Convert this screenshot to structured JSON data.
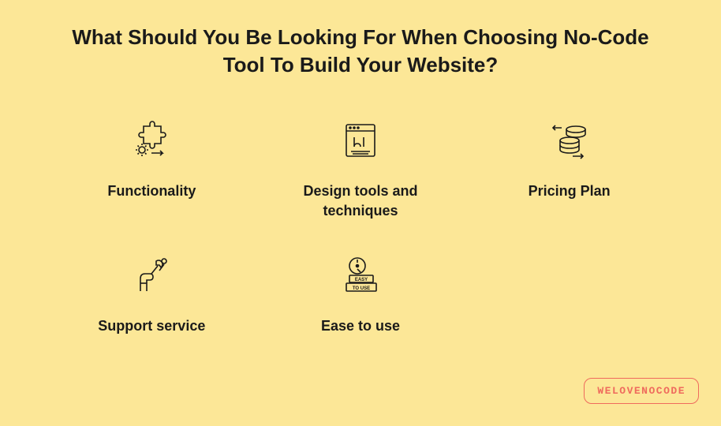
{
  "title": "What Should You Be Looking For When Choosing No-Code Tool To Build Your Website?",
  "items": [
    {
      "label": "Functionality",
      "icon": "puzzle-gear-icon"
    },
    {
      "label": "Design tools and techniques",
      "icon": "ui-window-icon"
    },
    {
      "label": "Pricing Plan",
      "icon": "database-arrows-icon"
    },
    {
      "label": "Support service",
      "icon": "hand-wrench-icon"
    },
    {
      "label": "Ease to use",
      "icon": "easy-to-use-icon"
    }
  ],
  "brand": "WELOVENOCODE",
  "colors": {
    "background": "#fce797",
    "text": "#1a1a1a",
    "brand": "#ef6b5d"
  }
}
